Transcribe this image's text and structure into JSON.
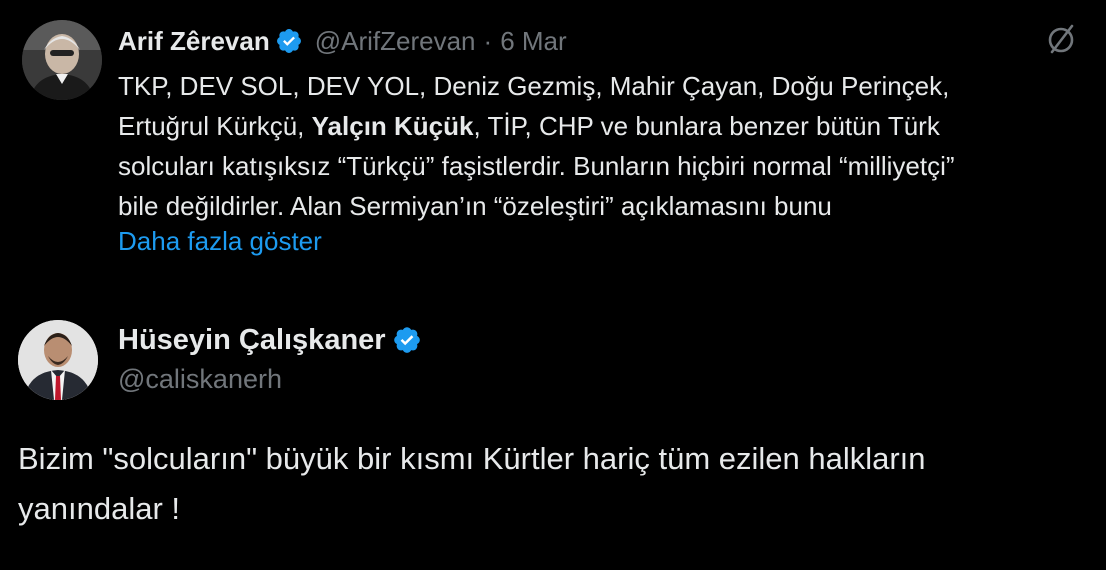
{
  "quoted_tweet": {
    "author_name": "Arif Zêrevan",
    "handle": "@ArifZerevan",
    "separator": "·",
    "date": "6 Mar",
    "avatar_icon": "profile-photo-arif",
    "body_lines": [
      {
        "parts": [
          {
            "text": "TKP, DEV SOL, DEV YOL, Deniz Gezmiş, Mahir Çayan, Doğu Perinçek,",
            "bold": false
          }
        ]
      },
      {
        "parts": [
          {
            "text": "Ertuğrul Kürkçü, ",
            "bold": false
          },
          {
            "text": "Yalçın Küçük",
            "bold": true
          },
          {
            "text": ", TİP, CHP ve bunlara benzer bütün Türk",
            "bold": false
          }
        ]
      },
      {
        "parts": [
          {
            "text": "solcuları katışıksız “Türkçü” faşistlerdir. Bunların hiçbiri normal “milliyetçi”",
            "bold": false
          }
        ]
      },
      {
        "parts": [
          {
            "text": "bile değildirler. Alan Sermiyan’ın “özeleştiri” açıklamasını bunu",
            "bold": false
          }
        ]
      }
    ],
    "show_more": "Daha fazla göster",
    "grok_icon": "grok-slash-circle-icon"
  },
  "tweet": {
    "author_name": "Hüseyin Çalışkaner",
    "handle": "@caliskanerh",
    "avatar_icon": "profile-photo-huseyin",
    "body_lines": [
      "Bizim \"solcuların\" büyük bir kısmı Kürtler hariç tüm ezilen halkların",
      "yanındalar !"
    ]
  },
  "colors": {
    "background": "#000000",
    "text": "#e7e9ea",
    "muted": "#71767b",
    "link": "#1d9bf0",
    "verified": "#1d9bf0"
  }
}
